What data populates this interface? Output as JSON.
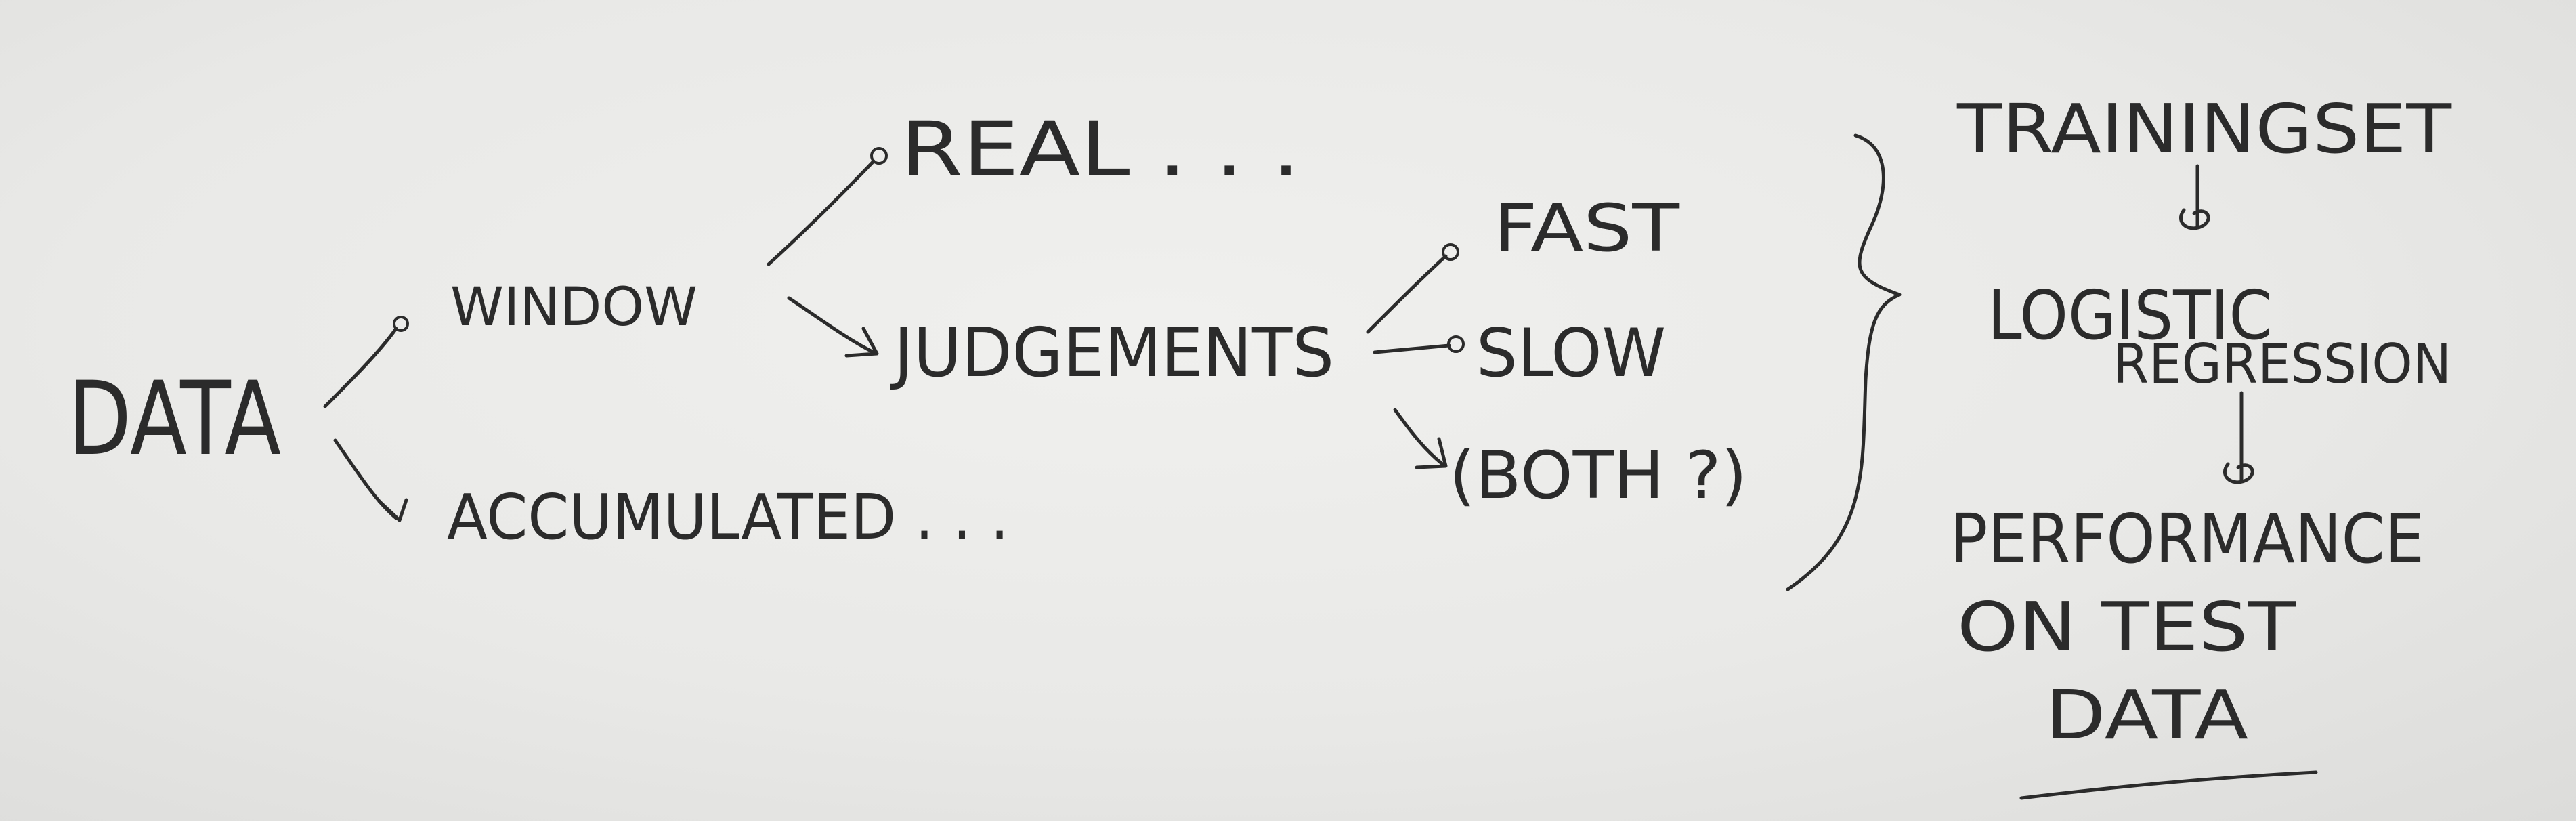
{
  "nodes": {
    "data": "DATA",
    "window": "WINDOW",
    "accumulated": "ACCUMULATED . . .",
    "real": "REAL . . .",
    "judgements": "JUDGEMENTS",
    "fast": "FAST",
    "slow": "SLOW",
    "both": "(BOTH ?)"
  },
  "pipeline": {
    "training_set": "TRAININGSET",
    "logistic": "LOGISTIC",
    "regression": "REGRESSION",
    "performance": "PERFORMANCE",
    "on_test": "ON TEST",
    "test_data": "DATA"
  },
  "colors": {
    "ink": "#2b2b2b",
    "paper": "#ebebe9"
  }
}
